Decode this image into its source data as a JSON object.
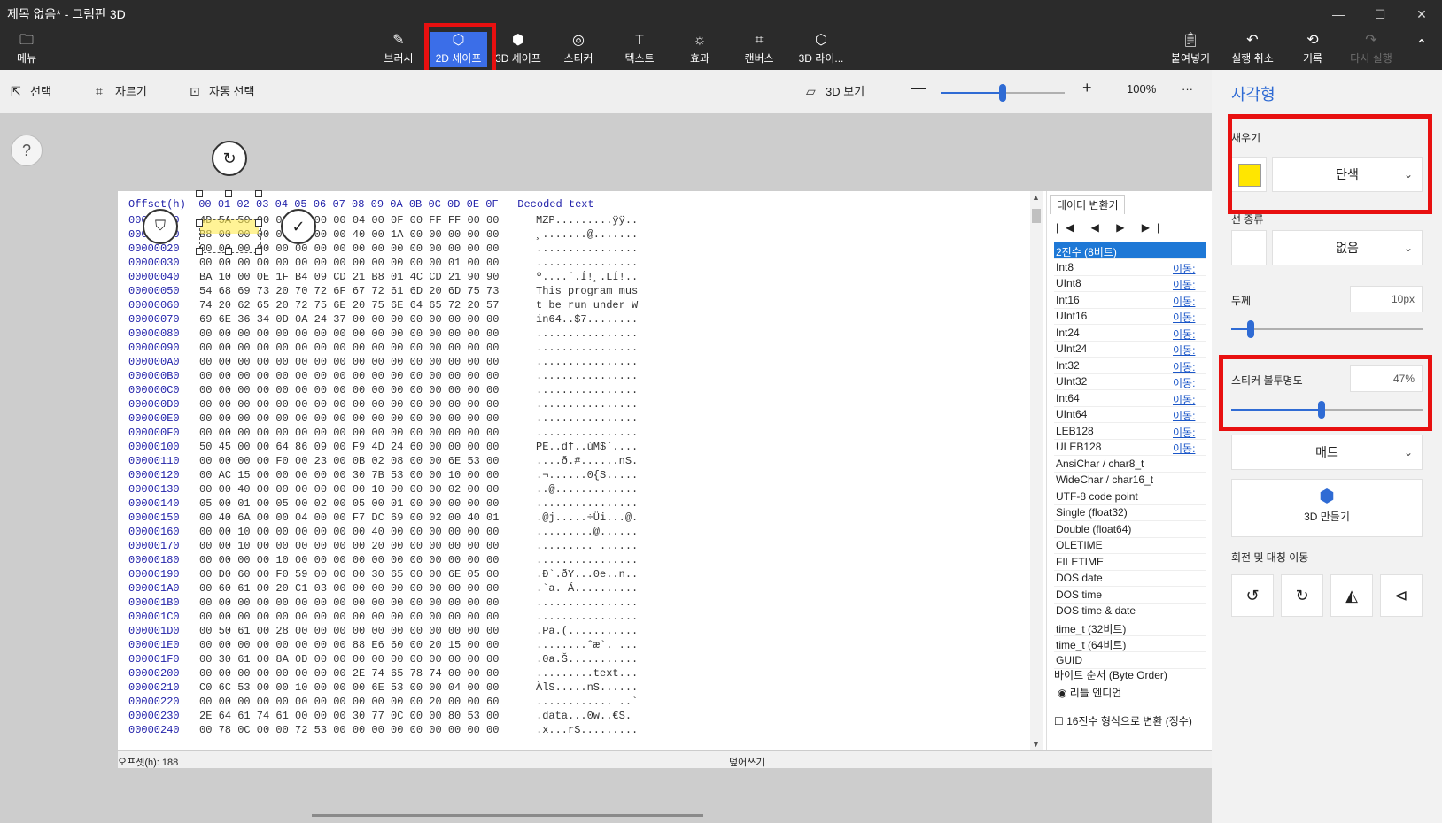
{
  "window": {
    "title": "제목 없음* - 그림판 3D",
    "controls": {
      "minimize": "—",
      "maximize": "☐",
      "close": "✕"
    }
  },
  "toolbar": {
    "menu": "메뉴",
    "brush": "브러시",
    "shapes2d": "2D 셰이프",
    "shapes3d": "3D 셰이프",
    "stickers": "스티커",
    "text": "텍스트",
    "effects": "효과",
    "canvas": "캔버스",
    "library3d": "3D 라이...",
    "paste": "붙여넣기",
    "undo": "실행 취소",
    "history": "기록",
    "redo": "다시 실행"
  },
  "subbar": {
    "select": "선택",
    "crop": "자르기",
    "magic_select": "자동 선택",
    "view3d": "3D 보기",
    "zoom": "100%",
    "zoom_level": 0.5,
    "more": "···"
  },
  "canvas": {
    "help": "?"
  },
  "hex": {
    "header": "Offset(h)  00 01 02 03 04 05 06 07 08 09 0A 0B 0C 0D 0E 0F   Decoded text",
    "rows": [
      {
        "off": "00000000",
        "bytes": "4D 5A 50 00 02 00 00 00 04 00 0F 00 FF FF 00 00",
        "dec": "MZP.........ÿÿ.."
      },
      {
        "off": "00000010",
        "bytes": "B8 00 00 00 00 00 00 00 40 00 1A 00 00 00 00 00",
        "dec": "¸.......@......."
      },
      {
        "off": "00000020",
        "bytes": "00 00 00 00 00 00 00 00 00 00 00 00 00 00 00 00",
        "dec": "................"
      },
      {
        "off": "00000030",
        "bytes": "00 00 00 00 00 00 00 00 00 00 00 00 00 01 00 00",
        "dec": "................"
      },
      {
        "off": "00000040",
        "bytes": "BA 10 00 0E 1F B4 09 CD 21 B8 01 4C CD 21 90 90",
        "dec": "º....´.Í!¸.LÍ!.."
      },
      {
        "off": "00000050",
        "bytes": "54 68 69 73 20 70 72 6F 67 72 61 6D 20 6D 75 73",
        "dec": "This program mus"
      },
      {
        "off": "00000060",
        "bytes": "74 20 62 65 20 72 75 6E 20 75 6E 64 65 72 20 57",
        "dec": "t be run under W"
      },
      {
        "off": "00000070",
        "bytes": "69 6E 36 34 0D 0A 24 37 00 00 00 00 00 00 00 00",
        "dec": "in64..$7........"
      },
      {
        "off": "00000080",
        "bytes": "00 00 00 00 00 00 00 00 00 00 00 00 00 00 00 00",
        "dec": "................"
      },
      {
        "off": "00000090",
        "bytes": "00 00 00 00 00 00 00 00 00 00 00 00 00 00 00 00",
        "dec": "................"
      },
      {
        "off": "000000A0",
        "bytes": "00 00 00 00 00 00 00 00 00 00 00 00 00 00 00 00",
        "dec": "................"
      },
      {
        "off": "000000B0",
        "bytes": "00 00 00 00 00 00 00 00 00 00 00 00 00 00 00 00",
        "dec": "................"
      },
      {
        "off": "000000C0",
        "bytes": "00 00 00 00 00 00 00 00 00 00 00 00 00 00 00 00",
        "dec": "................"
      },
      {
        "off": "000000D0",
        "bytes": "00 00 00 00 00 00 00 00 00 00 00 00 00 00 00 00",
        "dec": "................"
      },
      {
        "off": "000000E0",
        "bytes": "00 00 00 00 00 00 00 00 00 00 00 00 00 00 00 00",
        "dec": "................"
      },
      {
        "off": "000000F0",
        "bytes": "00 00 00 00 00 00 00 00 00 00 00 00 00 00 00 00",
        "dec": "................"
      },
      {
        "off": "00000100",
        "bytes": "50 45 00 00 64 86 09 00 F9 4D 24 60 00 00 00 00",
        "dec": "PE..d†..ùM$`...."
      },
      {
        "off": "00000110",
        "bytes": "00 00 00 00 F0 00 23 00 0B 02 08 00 00 6E 53 00",
        "dec": "....ð.#......nS."
      },
      {
        "off": "00000120",
        "bytes": "00 AC 15 00 00 00 00 00 30 7B 53 00 00 10 00 00",
        "dec": ".¬......0{S....."
      },
      {
        "off": "00000130",
        "bytes": "00 00 40 00 00 00 00 00 00 10 00 00 00 02 00 00",
        "dec": "..@............."
      },
      {
        "off": "00000140",
        "bytes": "05 00 01 00 05 00 02 00 05 00 01 00 00 00 00 00",
        "dec": "................"
      },
      {
        "off": "00000150",
        "bytes": "00 40 6A 00 00 04 00 00 F7 DC 69 00 02 00 40 01",
        "dec": ".@j.....÷Üi...@."
      },
      {
        "off": "00000160",
        "bytes": "00 00 10 00 00 00 00 00 00 40 00 00 00 00 00 00",
        "dec": ".........@......"
      },
      {
        "off": "00000170",
        "bytes": "00 00 10 00 00 00 00 00 00 20 00 00 00 00 00 00",
        "dec": "......... ......"
      },
      {
        "off": "00000180",
        "bytes": "00 00 00 00 10 00 00 00 00 00 00 00 00 00 00 00",
        "dec": "................"
      },
      {
        "off": "00000190",
        "bytes": "00 D0 60 00 F0 59 00 00 00 30 65 00 00 6E 05 00",
        "dec": ".Ð`.ðY...0e..n.."
      },
      {
        "off": "000001A0",
        "bytes": "00 60 61 00 20 C1 03 00 00 00 00 00 00 00 00 00",
        "dec": ".`a. Á.........."
      },
      {
        "off": "000001B0",
        "bytes": "00 00 00 00 00 00 00 00 00 00 00 00 00 00 00 00",
        "dec": "................"
      },
      {
        "off": "000001C0",
        "bytes": "00 00 00 00 00 00 00 00 00 00 00 00 00 00 00 00",
        "dec": "................"
      },
      {
        "off": "000001D0",
        "bytes": "00 50 61 00 28 00 00 00 00 00 00 00 00 00 00 00",
        "dec": ".Pa.(..........."
      },
      {
        "off": "000001E0",
        "bytes": "00 00 00 00 00 00 00 00 88 E6 60 00 20 15 00 00",
        "dec": "........ˆæ`. ..."
      },
      {
        "off": "000001F0",
        "bytes": "00 30 61 00 8A 0D 00 00 00 00 00 00 00 00 00 00",
        "dec": ".0a.Š..........."
      },
      {
        "off": "00000200",
        "bytes": "00 00 00 00 00 00 00 00 2E 74 65 78 74 00 00 00",
        "dec": ".........text..."
      },
      {
        "off": "00000210",
        "bytes": "C0 6C 53 00 00 10 00 00 00 6E 53 00 00 04 00 00",
        "dec": "ÀlS.....nS......"
      },
      {
        "off": "00000220",
        "bytes": "00 00 00 00 00 00 00 00 00 00 00 00 20 00 00 60",
        "dec": "............ ..`"
      },
      {
        "off": "00000230",
        "bytes": "2E 64 61 74 61 00 00 00 30 77 0C 00 00 80 53 00",
        "dec": ".data...0w..€S."
      },
      {
        "off": "00000240",
        "bytes": "00 78 0C 00 00 72 53 00 00 00 00 00 00 00 00 00",
        "dec": ".x...rS........."
      }
    ],
    "status_left": "오프셋(h): 188",
    "status_right": "덮어쓰기"
  },
  "inspector": {
    "tab": "데이터 변환기",
    "nav": "|◀ ◀ ▶ ▶|",
    "rows": [
      {
        "name": "2진수 (8비트)",
        "move": ""
      },
      {
        "name": "Int8",
        "move": "이동:"
      },
      {
        "name": "UInt8",
        "move": "이동:"
      },
      {
        "name": "Int16",
        "move": "이동:"
      },
      {
        "name": "UInt16",
        "move": "이동:"
      },
      {
        "name": "Int24",
        "move": "이동:"
      },
      {
        "name": "UInt24",
        "move": "이동:"
      },
      {
        "name": "Int32",
        "move": "이동:"
      },
      {
        "name": "UInt32",
        "move": "이동:"
      },
      {
        "name": "Int64",
        "move": "이동:"
      },
      {
        "name": "UInt64",
        "move": "이동:"
      },
      {
        "name": "LEB128",
        "move": "이동:"
      },
      {
        "name": "ULEB128",
        "move": "이동:"
      },
      {
        "name": "AnsiChar / char8_t",
        "move": ""
      },
      {
        "name": "WideChar / char16_t",
        "move": ""
      },
      {
        "name": "UTF-8 code point",
        "move": ""
      },
      {
        "name": "Single (float32)",
        "move": ""
      },
      {
        "name": "Double (float64)",
        "move": ""
      },
      {
        "name": "OLETIME",
        "move": ""
      },
      {
        "name": "FILETIME",
        "move": ""
      },
      {
        "name": "DOS date",
        "move": ""
      },
      {
        "name": "DOS time",
        "move": ""
      },
      {
        "name": "DOS time & date",
        "move": ""
      },
      {
        "name": "time_t (32비트)",
        "move": ""
      },
      {
        "name": "time_t (64비트)",
        "move": ""
      },
      {
        "name": "GUID",
        "move": ""
      }
    ],
    "byte_order": "바이트 순서 (Byte Order)",
    "little_endian": "◉ 리틀 엔디언",
    "hex_convert": "☐ 16진수 형식으로 변환 (정수)"
  },
  "right_panel": {
    "title": "사각형",
    "fill_label": "채우기",
    "fill_color": "#ffe600",
    "fill_type": "단색",
    "line_type_label": "선 종류",
    "line_type": "없음",
    "thickness_label": "두께",
    "thickness_value": "10px",
    "thickness_level": 0.1,
    "opacity_label": "스티커 불투명도",
    "opacity_value": "47%",
    "opacity_level": 0.47,
    "finish": "매트",
    "make3d": "3D 만들기",
    "rotate_flip_label": "회전 및 대칭 이동"
  }
}
